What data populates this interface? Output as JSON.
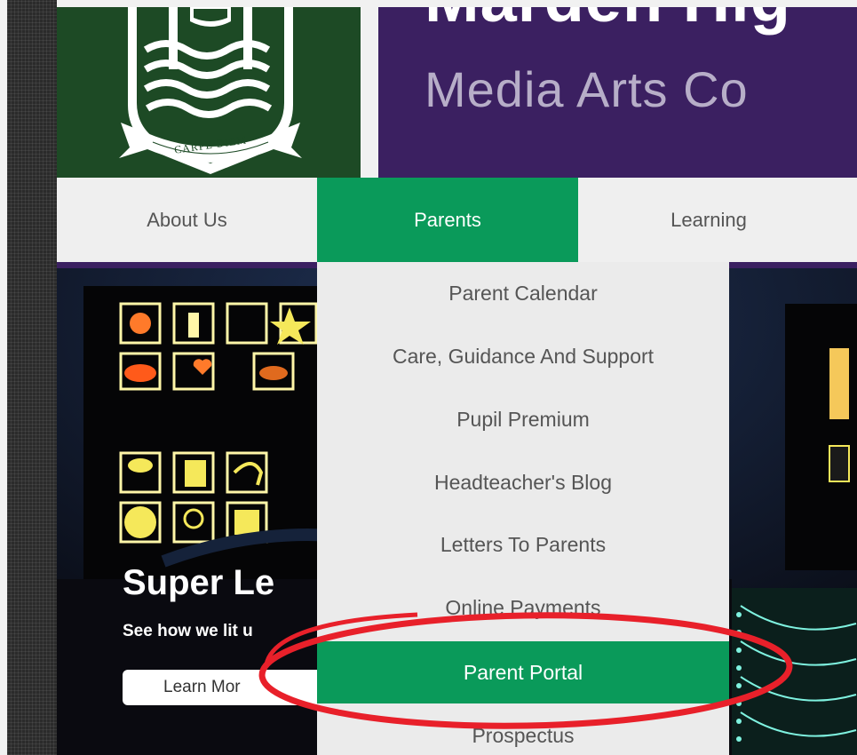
{
  "header": {
    "title_line1": "Marden Hig",
    "title_line2": "Media Arts Co",
    "logo": {
      "motto": "CARPE DIEM",
      "icon": "school-crest-icon"
    }
  },
  "nav": {
    "items": [
      {
        "label": "About Us",
        "active": false
      },
      {
        "label": "Parents",
        "active": true
      },
      {
        "label": "Learning",
        "active": false
      }
    ]
  },
  "dropdown": {
    "items": [
      {
        "label": "Parent Calendar"
      },
      {
        "label": "Care, Guidance And Support"
      },
      {
        "label": "Pupil Premium"
      },
      {
        "label": "Headteacher's Blog"
      },
      {
        "label": "Letters To Parents"
      },
      {
        "label": "Online Payments"
      },
      {
        "label": "Parent Portal",
        "highlighted": true
      },
      {
        "label": "Prospectus"
      }
    ]
  },
  "hero": {
    "headline": "Super Le",
    "subtext": "See how we lit u",
    "button_label": "Learn Mor"
  },
  "colors": {
    "brand_green": "#0a9a5a",
    "crest_green": "#1d4a25",
    "brand_purple": "#3b2061",
    "annotation_red": "#e8202a"
  }
}
